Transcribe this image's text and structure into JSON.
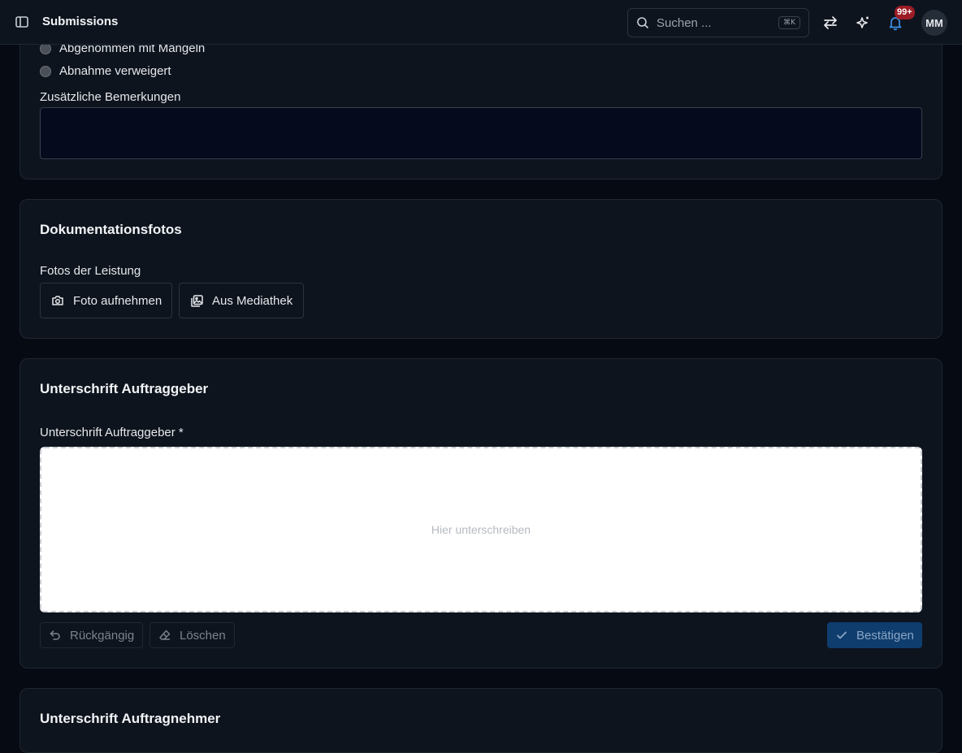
{
  "header": {
    "title": "Submissions",
    "search_placeholder": "Suchen ...",
    "search_shortcut": "⌘K",
    "notification_badge": "99+",
    "avatar_initials": "MM",
    "icons": [
      "sidebar-toggle-icon",
      "search-icon",
      "switch-arrows-icon",
      "sparkles-icon",
      "bell-icon"
    ]
  },
  "acceptance": {
    "options": [
      "Abgenommen mit Mängeln",
      "Abnahme verweigert"
    ],
    "remarks_label": "Zusätzliche Bemerkungen",
    "remarks_value": ""
  },
  "photos": {
    "title": "Dokumentationsfotos",
    "field_label": "Fotos der Leistung",
    "take_photo_label": "Foto aufnehmen",
    "library_label": "Aus Mediathek"
  },
  "client_signature": {
    "title": "Unterschrift Auftraggeber",
    "field_label": "Unterschrift Auftraggeber *",
    "placeholder": "Hier unterschreiben",
    "undo_label": "Rückgängig",
    "clear_label": "Löschen",
    "confirm_label": "Bestätigen"
  },
  "contractor_signature": {
    "title": "Unterschrift Auftragnehmer"
  },
  "colors": {
    "background": "#060a12",
    "card": "#0e141d",
    "primary_button": "#0f3d6e",
    "badge": "#9b1c24"
  }
}
